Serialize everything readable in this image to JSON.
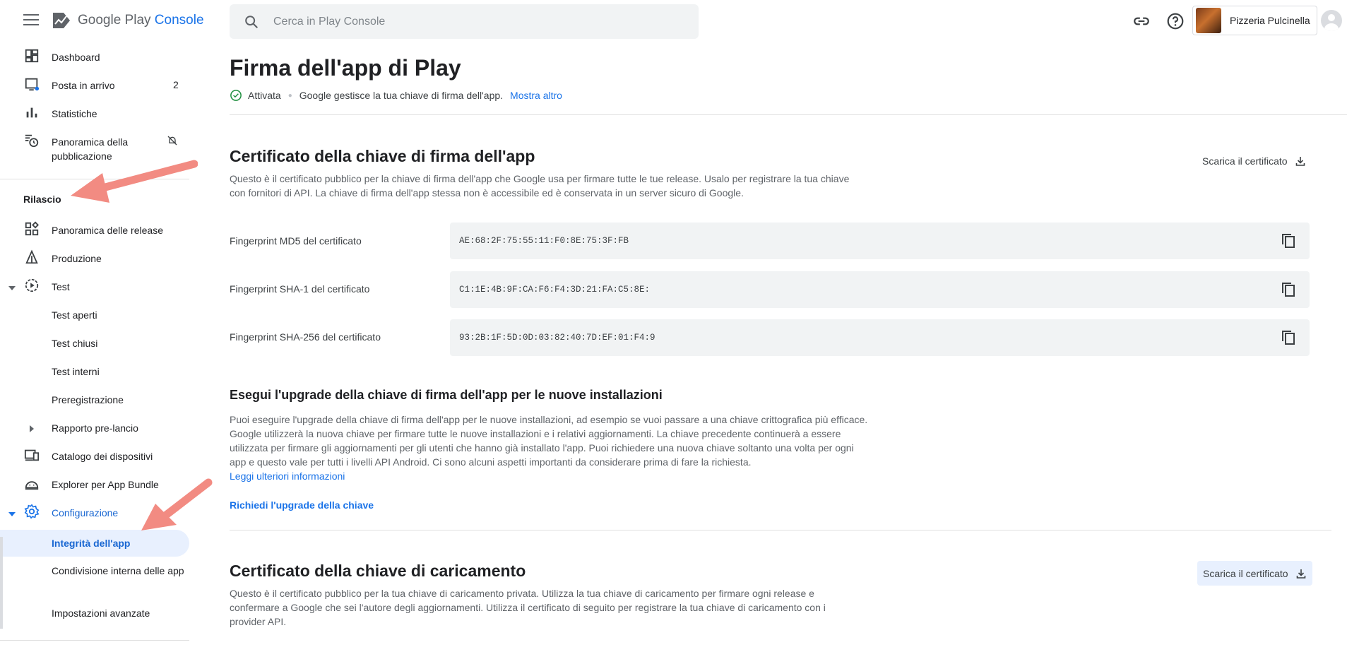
{
  "header": {
    "logo_brand": "Google Play",
    "logo_console": "Console",
    "search_placeholder": "Cerca in Play Console",
    "link_icon": "link-icon",
    "help_icon": "help-icon",
    "account_name": "Pizzeria Pulcinella"
  },
  "sidebar": {
    "items": [
      {
        "label": "Dashboard",
        "icon": "dashboard-icon"
      },
      {
        "label": "Posta in arrivo",
        "icon": "inbox-icon",
        "count": "2"
      },
      {
        "label": "Statistiche",
        "icon": "bar-chart-icon"
      },
      {
        "label": "Panoramica della pubblicazione",
        "icon": "publishing-overview-icon"
      }
    ],
    "section_release": "Rilascio",
    "release_items": [
      {
        "label": "Panoramica delle release"
      },
      {
        "label": "Produzione"
      },
      {
        "label": "Test"
      },
      {
        "label": "Test aperti"
      },
      {
        "label": "Test chiusi"
      },
      {
        "label": "Test interni"
      },
      {
        "label": "Preregistrazione"
      },
      {
        "label": "Rapporto pre-lancio"
      },
      {
        "label": "Catalogo dei dispositivi"
      },
      {
        "label": "Explorer per App Bundle"
      },
      {
        "label": "Configurazione"
      },
      {
        "label": "Integrità dell'app"
      },
      {
        "label": "Condivisione interna delle app"
      },
      {
        "label": "Impostazioni avanzate"
      }
    ]
  },
  "main": {
    "title": "Firma dell'app di Play",
    "status": "Attivata",
    "status_desc": "Google gestisce la tua chiave di firma dell'app.",
    "show_more": "Mostra altro",
    "signing_cert": {
      "title": "Certificato della chiave di firma dell'app",
      "download": "Scarica il certificato",
      "desc": "Questo è il certificato pubblico per la chiave di firma dell'app che Google usa per firmare tutte le tue release. Usalo per registrare la tua chiave con fornitori di API. La chiave di firma dell'app stessa non è accessibile ed è conservata in un server sicuro di Google.",
      "fingerprints": [
        {
          "label": "Fingerprint MD5 del certificato",
          "value": "AE:68:2F:75:55:11:F0:8E:75:3F:FB"
        },
        {
          "label": "Fingerprint SHA-1 del certificato",
          "value": "C1:1E:4B:9F:CA:F6:F4:3D:21:FA:C5:8E:"
        },
        {
          "label": "Fingerprint SHA-256 del certificato",
          "value": "93:2B:1F:5D:0D:03:82:40:7D:EF:01:F4:9"
        }
      ]
    },
    "upgrade": {
      "title": "Esegui l'upgrade della chiave di firma dell'app per le nuove installazioni",
      "desc": "Puoi eseguire l'upgrade della chiave di firma dell'app per le nuove installazioni, ad esempio se vuoi passare a una chiave crittografica più efficace. Google utilizzerà la nuova chiave per firmare tutte le nuove installazioni e i relativi aggiornamenti. La chiave precedente continuerà a essere utilizzata per firmare gli aggiornamenti per gli utenti che hanno già installato l'app. Puoi richiedere una nuova chiave soltanto una volta per ogni app e questo vale per tutti i livelli API Android. Ci sono alcuni aspetti importanti da considerare prima di fare la richiesta.",
      "learn_more": "Leggi ulteriori informazioni",
      "request_button": "Richiedi l'upgrade della chiave"
    },
    "upload_cert": {
      "title": "Certificato della chiave di caricamento",
      "download": "Scarica il certificato",
      "desc": "Questo è il certificato pubblico per la tua chiave di caricamento privata. Utilizza la tua chiave di caricamento per firmare ogni release e confermare a Google che sei l'autore degli aggiornamenti. Utilizza il certificato di seguito per registrare la tua chiave di caricamento con i provider API."
    }
  },
  "colors": {
    "accent": "#1a73e8",
    "active_bg": "#e8f0fe",
    "annotation_arrow": "#f28b82",
    "status_green": "#1e8e3e"
  }
}
